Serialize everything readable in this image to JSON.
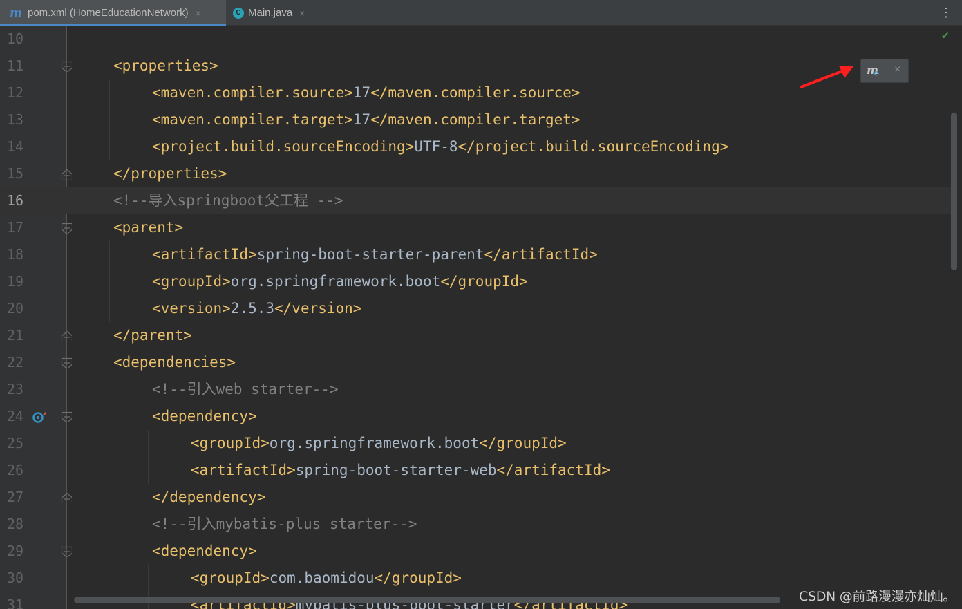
{
  "tabs": [
    {
      "label": "pom.xml (HomeEducationNetwork)",
      "icon": "maven-icon",
      "active": true,
      "close": "×"
    },
    {
      "label": "Main.java",
      "icon": "java-class-icon",
      "active": false,
      "close": "×"
    }
  ],
  "tab_icons": {
    "maven": "m",
    "java": "C"
  },
  "more_menu": "⋮",
  "status_check": "✔",
  "popup": {
    "icon_letter": "m",
    "close": "×"
  },
  "colors": {
    "background": "#2b2b2b",
    "gutter": "#313335",
    "tag": "#e8bf6a",
    "text": "#a9b7c6",
    "comment": "#808080",
    "line_number": "#606366",
    "active_tab_underline": "#4a88c7",
    "annotation_arrow": "#ff1f1f"
  },
  "current_line": 16,
  "lines": [
    {
      "num": "10",
      "indent": 0,
      "parts": []
    },
    {
      "num": "11",
      "indent": 1,
      "fold": "open",
      "parts": [
        {
          "t": "tag",
          "v": "<properties>"
        }
      ]
    },
    {
      "num": "12",
      "indent": 2,
      "parts": [
        {
          "t": "tag",
          "v": "<maven.compiler.source>"
        },
        {
          "t": "txt",
          "v": "17"
        },
        {
          "t": "tag",
          "v": "</maven.compiler.source>"
        }
      ]
    },
    {
      "num": "13",
      "indent": 2,
      "parts": [
        {
          "t": "tag",
          "v": "<maven.compiler.target>"
        },
        {
          "t": "txt",
          "v": "17"
        },
        {
          "t": "tag",
          "v": "</maven.compiler.target>"
        }
      ]
    },
    {
      "num": "14",
      "indent": 2,
      "parts": [
        {
          "t": "tag",
          "v": "<project.build.sourceEncoding>"
        },
        {
          "t": "txt",
          "v": "UTF-8"
        },
        {
          "t": "tag",
          "v": "</project.build.sourceEncoding>"
        }
      ]
    },
    {
      "num": "15",
      "indent": 1,
      "fold": "close",
      "parts": [
        {
          "t": "tag",
          "v": "</properties>"
        }
      ]
    },
    {
      "num": "16",
      "indent": 1,
      "parts": [
        {
          "t": "cmt",
          "v": "<!--导入springboot父工程 -->"
        }
      ]
    },
    {
      "num": "17",
      "indent": 1,
      "fold": "open",
      "parts": [
        {
          "t": "tag",
          "v": "<parent>"
        }
      ]
    },
    {
      "num": "18",
      "indent": 2,
      "parts": [
        {
          "t": "tag",
          "v": "<artifactId>"
        },
        {
          "t": "txt",
          "v": "spring-boot-starter-parent"
        },
        {
          "t": "tag",
          "v": "</artifactId>"
        }
      ]
    },
    {
      "num": "19",
      "indent": 2,
      "parts": [
        {
          "t": "tag",
          "v": "<groupId>"
        },
        {
          "t": "txt",
          "v": "org.springframework.boot"
        },
        {
          "t": "tag",
          "v": "</groupId>"
        }
      ]
    },
    {
      "num": "20",
      "indent": 2,
      "parts": [
        {
          "t": "tag",
          "v": "<version>"
        },
        {
          "t": "txt",
          "v": "2.5.3"
        },
        {
          "t": "tag",
          "v": "</version>"
        }
      ]
    },
    {
      "num": "21",
      "indent": 1,
      "fold": "close",
      "parts": [
        {
          "t": "tag",
          "v": "</parent>"
        }
      ]
    },
    {
      "num": "22",
      "indent": 1,
      "fold": "open",
      "parts": [
        {
          "t": "tag",
          "v": "<dependencies>"
        }
      ]
    },
    {
      "num": "23",
      "indent": 2,
      "parts": [
        {
          "t": "cmt",
          "v": "<!--引入web starter-->"
        }
      ]
    },
    {
      "num": "24",
      "indent": 2,
      "fold": "open",
      "gutter_icon": true,
      "parts": [
        {
          "t": "tag",
          "v": "<dependency>"
        }
      ]
    },
    {
      "num": "25",
      "indent": 3,
      "parts": [
        {
          "t": "tag",
          "v": "<groupId>"
        },
        {
          "t": "txt",
          "v": "org.springframework.boot"
        },
        {
          "t": "tag",
          "v": "</groupId>"
        }
      ]
    },
    {
      "num": "26",
      "indent": 3,
      "parts": [
        {
          "t": "tag",
          "v": "<artifactId>"
        },
        {
          "t": "txt",
          "v": "spring-boot-starter-web"
        },
        {
          "t": "tag",
          "v": "</artifactId>"
        }
      ]
    },
    {
      "num": "27",
      "indent": 2,
      "fold": "close",
      "parts": [
        {
          "t": "tag",
          "v": "</dependency>"
        }
      ]
    },
    {
      "num": "28",
      "indent": 2,
      "parts": [
        {
          "t": "cmt",
          "v": "<!--引入mybatis-plus starter-->"
        }
      ]
    },
    {
      "num": "29",
      "indent": 2,
      "fold": "open",
      "parts": [
        {
          "t": "tag",
          "v": "<dependency>"
        }
      ]
    },
    {
      "num": "30",
      "indent": 3,
      "parts": [
        {
          "t": "tag",
          "v": "<groupId>"
        },
        {
          "t": "txt",
          "v": "com.baomidou"
        },
        {
          "t": "tag",
          "v": "</groupId>"
        }
      ]
    },
    {
      "num": "31",
      "indent": 3,
      "parts": [
        {
          "t": "tag",
          "v": "<artifactId>"
        },
        {
          "t": "txt",
          "v": "mybatis-plus-boot-starter"
        },
        {
          "t": "tag",
          "v": "</artifactId>"
        }
      ]
    }
  ],
  "watermark": "CSDN @前路漫漫亦灿灿。"
}
